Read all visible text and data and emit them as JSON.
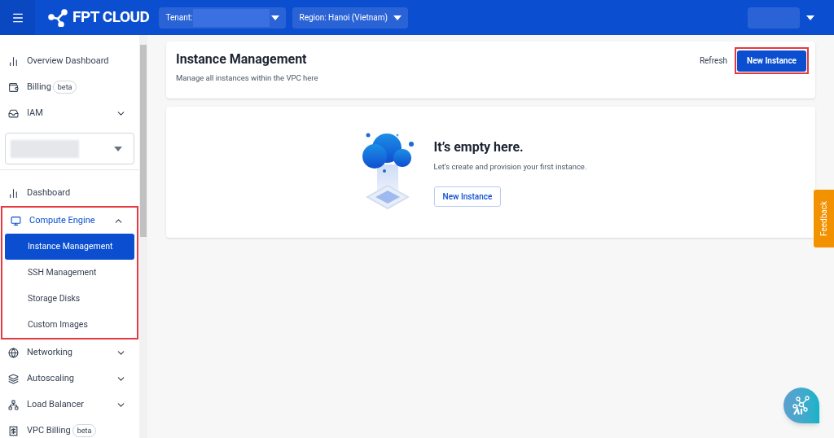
{
  "header": {
    "logo": "FPT CLOUD",
    "tenant": {
      "label": "Tenant:"
    },
    "region": {
      "label": "Region: Hanoi (Vietnam)"
    }
  },
  "sidebar": {
    "items": [
      {
        "kind": "link",
        "label": "Overview Dashboard"
      },
      {
        "kind": "link",
        "label": "Billing",
        "badge": "beta"
      },
      {
        "kind": "group",
        "label": "IAM",
        "expanded": false
      },
      {
        "kind": "select"
      },
      {
        "kind": "link",
        "label": "Dashboard"
      },
      {
        "kind": "group",
        "label": "Compute Engine",
        "expanded": true,
        "highlighted": true,
        "children": [
          {
            "label": "Instance Management",
            "selected": true
          },
          {
            "label": "SSH Management",
            "selected": false
          },
          {
            "label": "Storage Disks",
            "selected": false
          },
          {
            "label": "Custom Images",
            "selected": false
          }
        ]
      },
      {
        "kind": "group",
        "label": "Networking",
        "expanded": false
      },
      {
        "kind": "group",
        "label": "Autoscaling",
        "expanded": false
      },
      {
        "kind": "group",
        "label": "Load Balancer",
        "expanded": false
      },
      {
        "kind": "link",
        "label": "VPC Billing",
        "badge": "beta"
      }
    ]
  },
  "page": {
    "title": "Instance Management",
    "subtitle": "Manage all instances within the VPC here",
    "refresh": "Refresh",
    "new_button": {
      "label": "New Instance",
      "highlighted": true
    }
  },
  "empty": {
    "title": "It’s empty here.",
    "text": "Let’s create and provision your first instance.",
    "button": "New Instance"
  },
  "feedback": "Feedback"
}
